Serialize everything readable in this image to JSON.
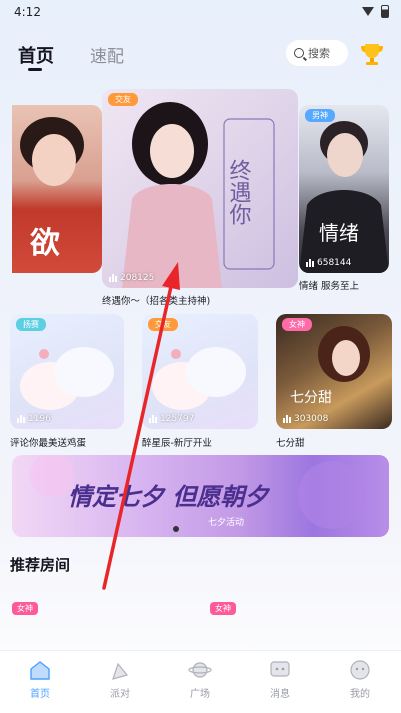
{
  "status_bar": {
    "time": "4:12"
  },
  "header": {
    "tabs": [
      "首页",
      "速配"
    ],
    "search_label": "搜索"
  },
  "carousel": {
    "left": {
      "art_text": "欲"
    },
    "main": {
      "tag": "交友",
      "views": "208125",
      "caption": "终遇你～（招各类主持神)",
      "art_text": "终遇你"
    },
    "right": {
      "tag": "男神",
      "views": "658144",
      "caption": "情绪 服务至上",
      "art_text": "情绪"
    }
  },
  "rooms_row": [
    {
      "tag": "扬赛",
      "views": "1196",
      "caption": "评论你最美送鸡蛋"
    },
    {
      "tag": "交友",
      "views": "125797",
      "caption": "醉星辰-新厅开业"
    },
    {
      "tag": "女神",
      "views": "303008",
      "caption": "七分甜",
      "art_text": "七分甜"
    }
  ],
  "banner": {
    "text": "情定七夕 但愿朝夕",
    "sub": "七夕活动"
  },
  "recommend": {
    "title": "推荐房间",
    "tags": [
      "女神",
      "女神"
    ]
  },
  "nav": [
    {
      "label": "首页",
      "icon": "home-icon",
      "active": true
    },
    {
      "label": "派对",
      "icon": "party-icon",
      "active": false
    },
    {
      "label": "广场",
      "icon": "planet-icon",
      "active": false
    },
    {
      "label": "消息",
      "icon": "message-icon",
      "active": false
    },
    {
      "label": "我的",
      "icon": "profile-icon",
      "active": false
    }
  ],
  "colors": {
    "accent": "#4da0ff",
    "tag_pink": "#ff5a9a",
    "tag_orange": "#ff9a3c",
    "tag_blue": "#57a8ff"
  }
}
